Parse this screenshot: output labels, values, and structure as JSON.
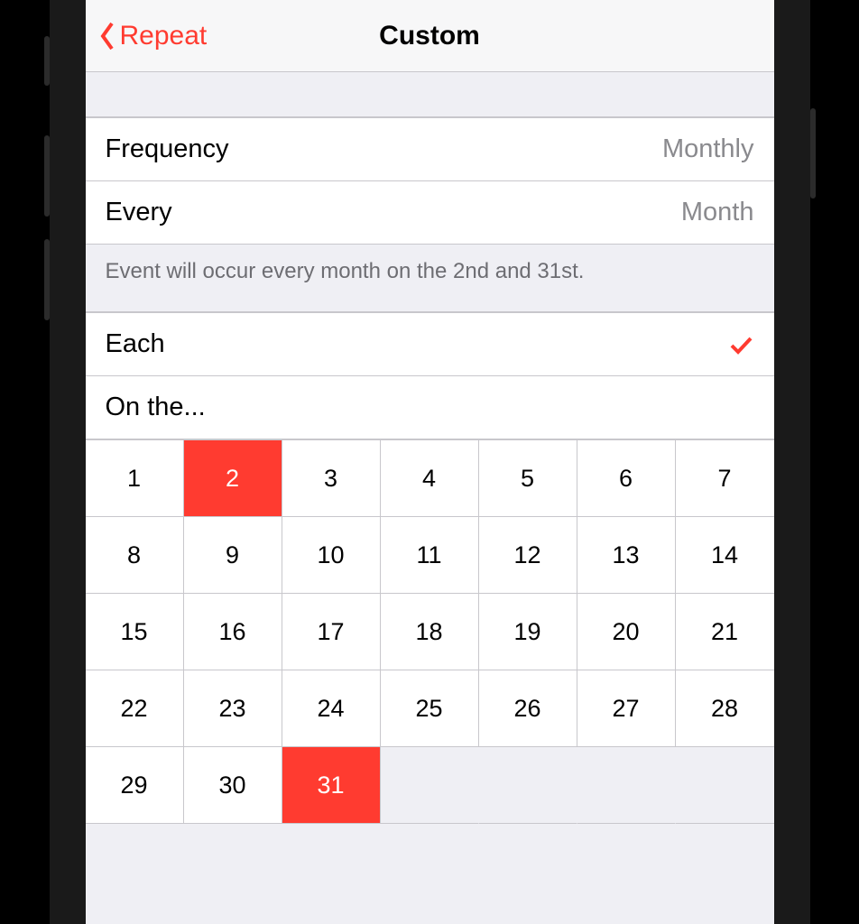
{
  "nav": {
    "back_label": "Repeat",
    "title": "Custom"
  },
  "rows": {
    "frequency_label": "Frequency",
    "frequency_value": "Monthly",
    "every_label": "Every",
    "every_value": "Month",
    "each_label": "Each",
    "onthe_label": "On the..."
  },
  "note": "Event will occur every month on the 2nd and 31st.",
  "days": {
    "d1": "1",
    "d2": "2",
    "d3": "3",
    "d4": "4",
    "d5": "5",
    "d6": "6",
    "d7": "7",
    "d8": "8",
    "d9": "9",
    "d10": "10",
    "d11": "11",
    "d12": "12",
    "d13": "13",
    "d14": "14",
    "d15": "15",
    "d16": "16",
    "d17": "17",
    "d18": "18",
    "d19": "19",
    "d20": "20",
    "d21": "21",
    "d22": "22",
    "d23": "23",
    "d24": "24",
    "d25": "25",
    "d26": "26",
    "d27": "27",
    "d28": "28",
    "d29": "29",
    "d30": "30",
    "d31": "31"
  },
  "selected_days": [
    2,
    31
  ],
  "colors": {
    "accent": "#ff3b30"
  }
}
